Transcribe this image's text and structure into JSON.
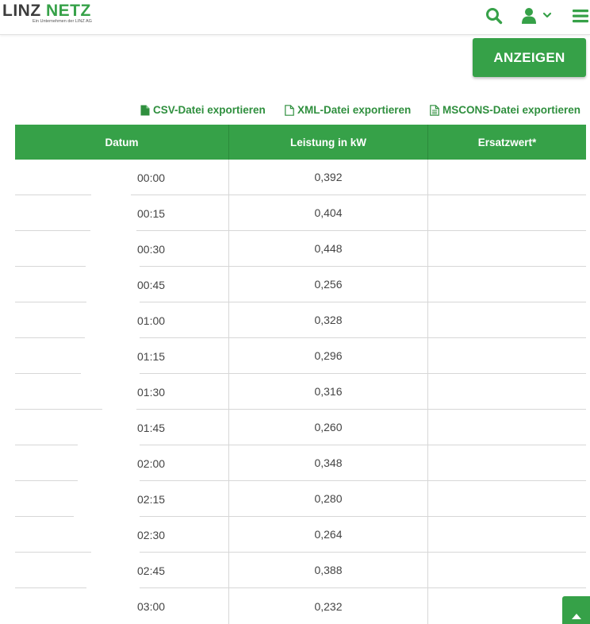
{
  "header": {
    "logo_linz": "LINZ",
    "logo_netz": "NETZ",
    "logo_sub": "Ein Unternehmen der LINZ AG",
    "icons": [
      "search-icon",
      "user-icon",
      "chevron-down-icon",
      "menu-icon"
    ]
  },
  "actions": {
    "anzeigen_label": "ANZEIGEN"
  },
  "exports": {
    "csv_label": "CSV-Datei exportieren",
    "xml_label": "XML-Datei exportieren",
    "mscons_label": "MSCONS-Datei exportieren"
  },
  "table": {
    "headers": {
      "datum": "Datum",
      "leistung": "Leistung in kW",
      "ersatzwert": "Ersatzwert*"
    },
    "rows": [
      {
        "time": "00:00",
        "value": "0,392",
        "ersatz": ""
      },
      {
        "time": "00:15",
        "value": "0,404",
        "ersatz": ""
      },
      {
        "time": "00:30",
        "value": "0,448",
        "ersatz": ""
      },
      {
        "time": "00:45",
        "value": "0,256",
        "ersatz": ""
      },
      {
        "time": "01:00",
        "value": "0,328",
        "ersatz": ""
      },
      {
        "time": "01:15",
        "value": "0,296",
        "ersatz": ""
      },
      {
        "time": "01:30",
        "value": "0,316",
        "ersatz": ""
      },
      {
        "time": "01:45",
        "value": "0,260",
        "ersatz": ""
      },
      {
        "time": "02:00",
        "value": "0,348",
        "ersatz": ""
      },
      {
        "time": "02:15",
        "value": "0,280",
        "ersatz": ""
      },
      {
        "time": "02:30",
        "value": "0,264",
        "ersatz": ""
      },
      {
        "time": "02:45",
        "value": "0,388",
        "ersatz": ""
      },
      {
        "time": "03:00",
        "value": "0,232",
        "ersatz": ""
      }
    ]
  },
  "colors": {
    "brand_green": "#36a148",
    "link_green": "#2f8f3e"
  }
}
